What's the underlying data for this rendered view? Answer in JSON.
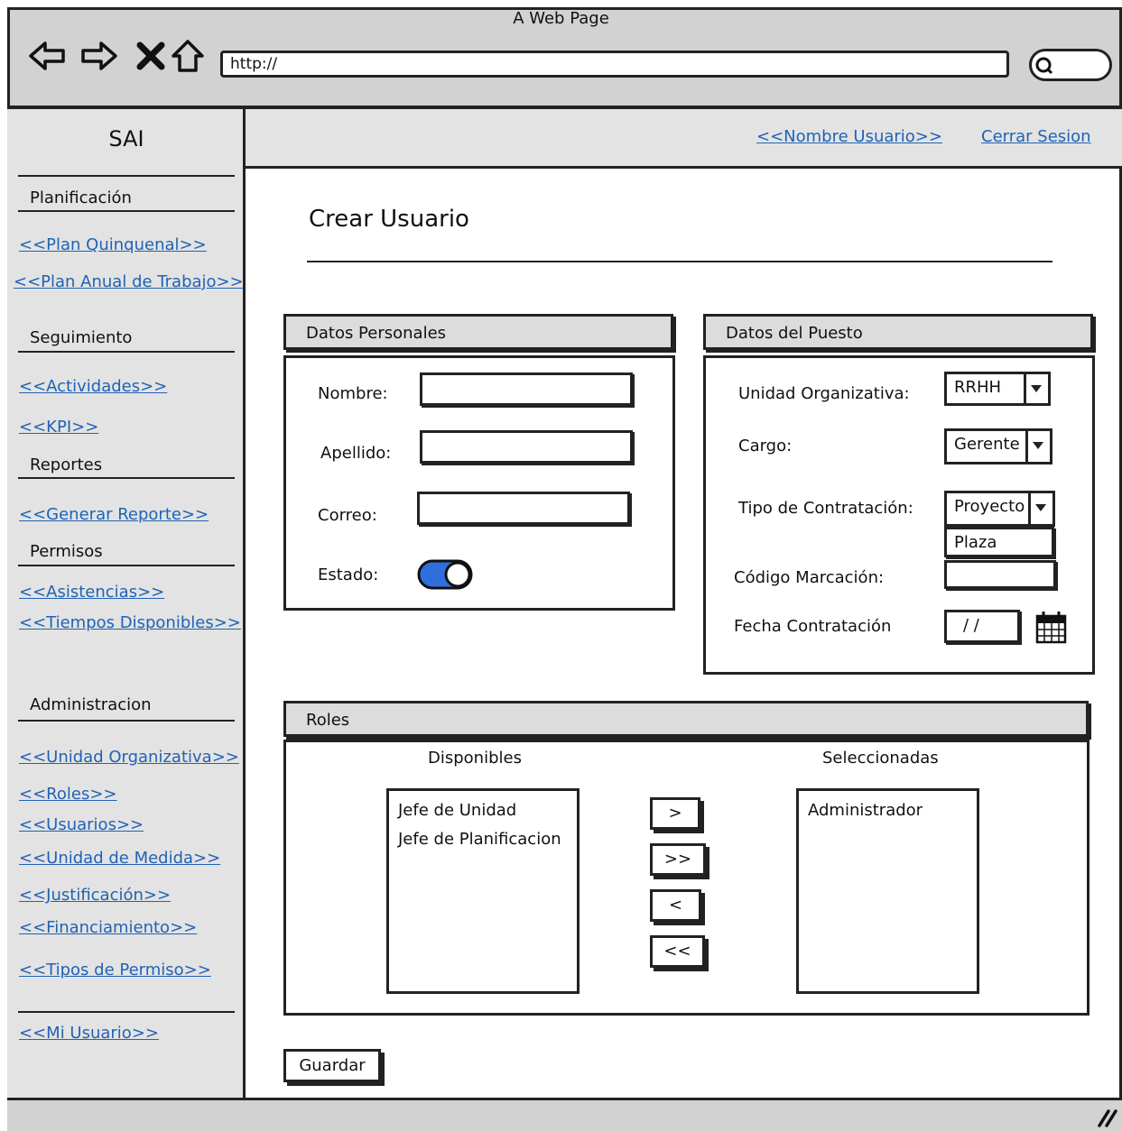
{
  "window": {
    "title": "A Web Page"
  },
  "browser": {
    "url": "http://",
    "icons": [
      "back-arrow-icon",
      "forward-arrow-icon",
      "close-x-icon",
      "home-icon",
      "search-icon"
    ]
  },
  "sidebar": {
    "app_title": "SAI",
    "sections": {
      "planificacion": {
        "title": "Planificación",
        "links": [
          "<<Plan Quinquenal>>",
          "<<Plan Anual de Trabajo>>"
        ]
      },
      "seguimiento": {
        "title": "Seguimiento",
        "links": [
          "<<Actividades>>",
          "<<KPI>>"
        ]
      },
      "reportes": {
        "title": "Reportes",
        "links": [
          "<<Generar Reporte>>"
        ]
      },
      "permisos": {
        "title": "Permisos",
        "links": [
          "<<Asistencias>>",
          "<<Tiempos Disponibles>>"
        ]
      },
      "administracion": {
        "title": "Administracion",
        "links": [
          "<<Unidad Organizativa>>",
          "<<Roles>>",
          "<<Usuarios>>",
          "<<Unidad de Medida>>",
          "<<Justificación>>",
          "<<Financiamiento>>",
          "<<Tipos de Permiso>>"
        ]
      }
    },
    "my_user": "<<Mi Usuario>>"
  },
  "header": {
    "user_name": "<<Nombre Usuario>>",
    "logout": "Cerrar Sesion"
  },
  "page": {
    "title": "Crear Usuario"
  },
  "personal": {
    "title": "Datos Personales",
    "nombre_label": "Nombre:",
    "apellido_label": "Apellido:",
    "correo_label": "Correo:",
    "estado_label": "Estado:",
    "estado_on": true,
    "toggle_color": "#2f6fdb"
  },
  "puesto": {
    "title": "Datos del Puesto",
    "unidad_label": "Unidad Organizativa:",
    "unidad_value": "RRHH",
    "cargo_label": "Cargo:",
    "cargo_value": "Gerente",
    "tipo_label": "Tipo de Contratación:",
    "tipo_value": "Proyecto",
    "tipo_option": "Plaza",
    "codigo_label": "Código Marcación:",
    "fecha_label": "Fecha Contratación",
    "fecha_value": "/ /"
  },
  "roles": {
    "title": "Roles",
    "available_title": "Disponibles",
    "selected_title": "Seleccionadas",
    "available": [
      "Jefe de Unidad",
      "Jefe de Planificacion"
    ],
    "selected": [
      "Administrador"
    ],
    "buttons": [
      ">",
      ">>",
      "<",
      "<<"
    ]
  },
  "actions": {
    "save": "Guardar"
  },
  "colors": {
    "link": "#1f63b5",
    "chrome": "#d2d2d2",
    "sidebar": "#e3e3e3"
  }
}
